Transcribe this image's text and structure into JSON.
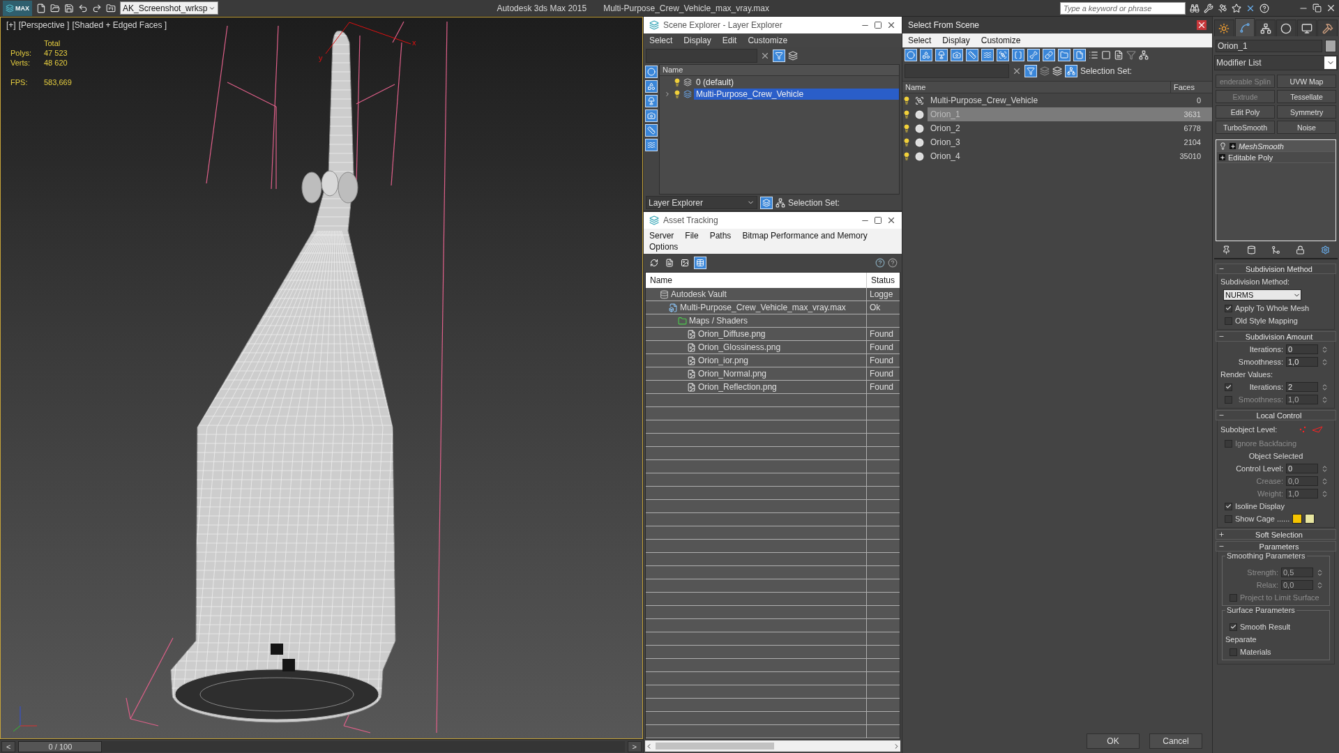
{
  "title_bar": {
    "app_button": "MAX",
    "workspace": "AK_Screenshot_wrksp",
    "app_title": "Autodesk 3ds Max  2015",
    "file_name": "Multi-Purpose_Crew_Vehicle_max_vray.max",
    "search": {
      "placeholder": "Type a keyword or phrase"
    }
  },
  "viewport": {
    "labels": [
      "[+]",
      "[Perspective ]",
      "[Shaded + Edged Faces ]"
    ],
    "stats_header": "Total",
    "stats": [
      {
        "label": "Polys:",
        "value": "47 523"
      },
      {
        "label": "Verts:",
        "value": "48 620"
      }
    ],
    "fps": {
      "label": "FPS:",
      "value": "583,669"
    },
    "gizmo_axes": [
      "x",
      "y"
    ]
  },
  "time_slider": {
    "prev": "<",
    "frame": "0 / 100",
    "next": ">"
  },
  "scene_explorer": {
    "title": "Scene Explorer - Layer Explorer",
    "menu": [
      "Select",
      "Display",
      "Edit",
      "Customize"
    ],
    "filters": [
      {
        "on": true
      },
      {
        "on": true
      },
      {
        "on": true
      },
      {
        "on": true
      },
      {
        "on": true
      },
      {
        "on": true
      }
    ],
    "column": "Name",
    "layers": [
      {
        "name": "0 (default)",
        "expandable": false,
        "selected": false
      },
      {
        "name": "Multi-Purpose_Crew_Vehicle",
        "expandable": true,
        "selected": true
      }
    ],
    "explorer_mode": "Layer Explorer",
    "selection_set": "Selection Set:"
  },
  "asset_tracking": {
    "title": "Asset Tracking",
    "menu": [
      "Server",
      "File",
      "Paths",
      "Bitmap Performance and Memory",
      "Options"
    ],
    "views": [
      {
        "selected": false
      },
      {
        "selected": false
      },
      {
        "selected": false
      },
      {
        "selected": true
      }
    ],
    "columns": [
      "Name",
      "Status"
    ],
    "assets": [
      {
        "kind": "vault",
        "name": "Autodesk Vault",
        "status": "Logge",
        "children": [
          {
            "kind": "max",
            "name": "Multi-Purpose_Crew_Vehicle_max_vray.max",
            "status": "Ok",
            "children": [
              {
                "kind": "folder",
                "name": "Maps / Shaders",
                "children": [
                  {
                    "kind": "image",
                    "name": "Orion_Diffuse.png",
                    "status": "Found"
                  },
                  {
                    "kind": "image",
                    "name": "Orion_Glossiness.png",
                    "status": "Found"
                  },
                  {
                    "kind": "image",
                    "name": "Orion_ior.png",
                    "status": "Found"
                  },
                  {
                    "kind": "image",
                    "name": "Orion_Normal.png",
                    "status": "Found"
                  },
                  {
                    "kind": "image",
                    "name": "Orion_Reflection.png",
                    "status": "Found"
                  }
                ]
              }
            ]
          }
        ]
      }
    ]
  },
  "select_from_scene": {
    "title": "Select From Scene",
    "menu": [
      "Select",
      "Display",
      "Customize"
    ],
    "filters": [
      {
        "on": true
      },
      {
        "on": true
      },
      {
        "on": true
      },
      {
        "on": true
      },
      {
        "on": true
      },
      {
        "on": true
      },
      {
        "on": true
      },
      {
        "on": true
      },
      {
        "on": true
      },
      {
        "on": true
      },
      {
        "on": true
      },
      {
        "on": true
      }
    ],
    "selection_set": "Selection Set:",
    "columns": [
      "Name",
      "Faces"
    ],
    "objects": [
      {
        "kind": "group",
        "name": "Multi-Purpose_Crew_Vehicle",
        "faces": "0",
        "selected": false
      },
      {
        "kind": "mesh",
        "name": "Orion_1",
        "faces": "3631",
        "selected": true
      },
      {
        "kind": "mesh",
        "name": "Orion_2",
        "faces": "6778",
        "selected": false
      },
      {
        "kind": "mesh",
        "name": "Orion_3",
        "faces": "2104",
        "selected": false
      },
      {
        "kind": "mesh",
        "name": "Orion_4",
        "faces": "35010",
        "selected": false
      }
    ],
    "buttons": [
      "OK",
      "Cancel"
    ]
  },
  "command_panel": {
    "tabs": [
      {
        "kind": "create",
        "selected": false
      },
      {
        "kind": "modify",
        "selected": true
      },
      {
        "kind": "hierarchy",
        "selected": false
      },
      {
        "kind": "motion",
        "selected": false
      },
      {
        "kind": "display",
        "selected": false
      },
      {
        "kind": "utilities",
        "selected": false
      }
    ],
    "object_name": "Orion_1",
    "modifier_list": "Modifier List",
    "modifier_buttons": [
      {
        "label": "enderable Splin",
        "disabled": true
      },
      {
        "label": "UVW Map",
        "disabled": false
      },
      {
        "label": "Extrude",
        "disabled": true
      },
      {
        "label": "Tessellate",
        "disabled": false
      },
      {
        "label": "Edit Poly",
        "disabled": false
      },
      {
        "label": "Symmetry",
        "disabled": false
      },
      {
        "label": "TurboSmooth",
        "disabled": false
      },
      {
        "label": "Noise",
        "disabled": false
      }
    ],
    "stack": [
      {
        "name": "MeshSmooth",
        "selected": true
      },
      {
        "name": "Editable Poly",
        "selected": false
      }
    ],
    "rollouts": [
      {
        "title": "Subdivision Method",
        "expanded": true,
        "items": [
          {
            "kind": "label",
            "text": "Subdivision Method:"
          },
          {
            "kind": "dropdown",
            "value": "NURMS"
          },
          {
            "kind": "check",
            "label": "Apply To Whole Mesh",
            "checked": true,
            "disabled": false
          },
          {
            "kind": "check",
            "label": "Old Style Mapping",
            "checked": false,
            "disabled": false
          }
        ]
      },
      {
        "title": "Subdivision Amount",
        "expanded": true,
        "items": [
          {
            "kind": "spinner",
            "label": "Iterations:",
            "value": "0",
            "disabled": false
          },
          {
            "kind": "spinner",
            "label": "Smoothness:",
            "value": "1,0",
            "disabled": false
          },
          {
            "kind": "label",
            "text": "Render Values:"
          },
          {
            "kind": "check_spinner",
            "label": "Iterations:",
            "value": "2",
            "checked": true,
            "disabled": false
          },
          {
            "kind": "check_spinner",
            "label": "Smoothness:",
            "value": "1,0",
            "checked": false,
            "disabled": true
          }
        ]
      },
      {
        "title": "Local Control",
        "expanded": true,
        "items": [
          {
            "kind": "subobject",
            "text": "Subobject Level:"
          },
          {
            "kind": "check",
            "label": "Ignore Backfacing",
            "checked": false,
            "disabled": true
          },
          {
            "kind": "status",
            "text": "Object Selected"
          },
          {
            "kind": "spinner",
            "label": "Control Level:",
            "value": "0",
            "disabled": false
          },
          {
            "kind": "spinner",
            "label": "Crease:",
            "value": "0,0",
            "disabled": true
          },
          {
            "kind": "spinner",
            "label": "Weight:",
            "value": "1,0",
            "disabled": true
          },
          {
            "kind": "check",
            "label": "Isoline Display",
            "checked": true,
            "disabled": false
          },
          {
            "kind": "cage",
            "label": "Show Cage ......",
            "checked": false,
            "swatches": [
              {
                "color": "#f5c400"
              },
              {
                "color": "#e8e6a0"
              }
            ]
          }
        ]
      },
      {
        "title": "Soft Selection",
        "expanded": false
      },
      {
        "title": "Parameters",
        "expanded": true,
        "items": [
          {
            "kind": "group",
            "title": "Smoothing Parameters",
            "items": [
              {
                "kind": "spinner",
                "label": "Strength:",
                "value": "0,5",
                "disabled": true
              },
              {
                "kind": "spinner",
                "label": "Relax:",
                "value": "0,0",
                "disabled": true
              },
              {
                "kind": "check",
                "label": "Project to Limit Surface",
                "checked": false,
                "disabled": true
              }
            ]
          },
          {
            "kind": "group",
            "title": "Surface Parameters",
            "items": [
              {
                "kind": "check",
                "label": "Smooth Result",
                "checked": true,
                "disabled": false
              },
              {
                "kind": "label",
                "text": "Separate"
              },
              {
                "kind": "check",
                "label": "Materials",
                "checked": false,
                "disabled": false
              }
            ]
          }
        ]
      }
    ]
  }
}
